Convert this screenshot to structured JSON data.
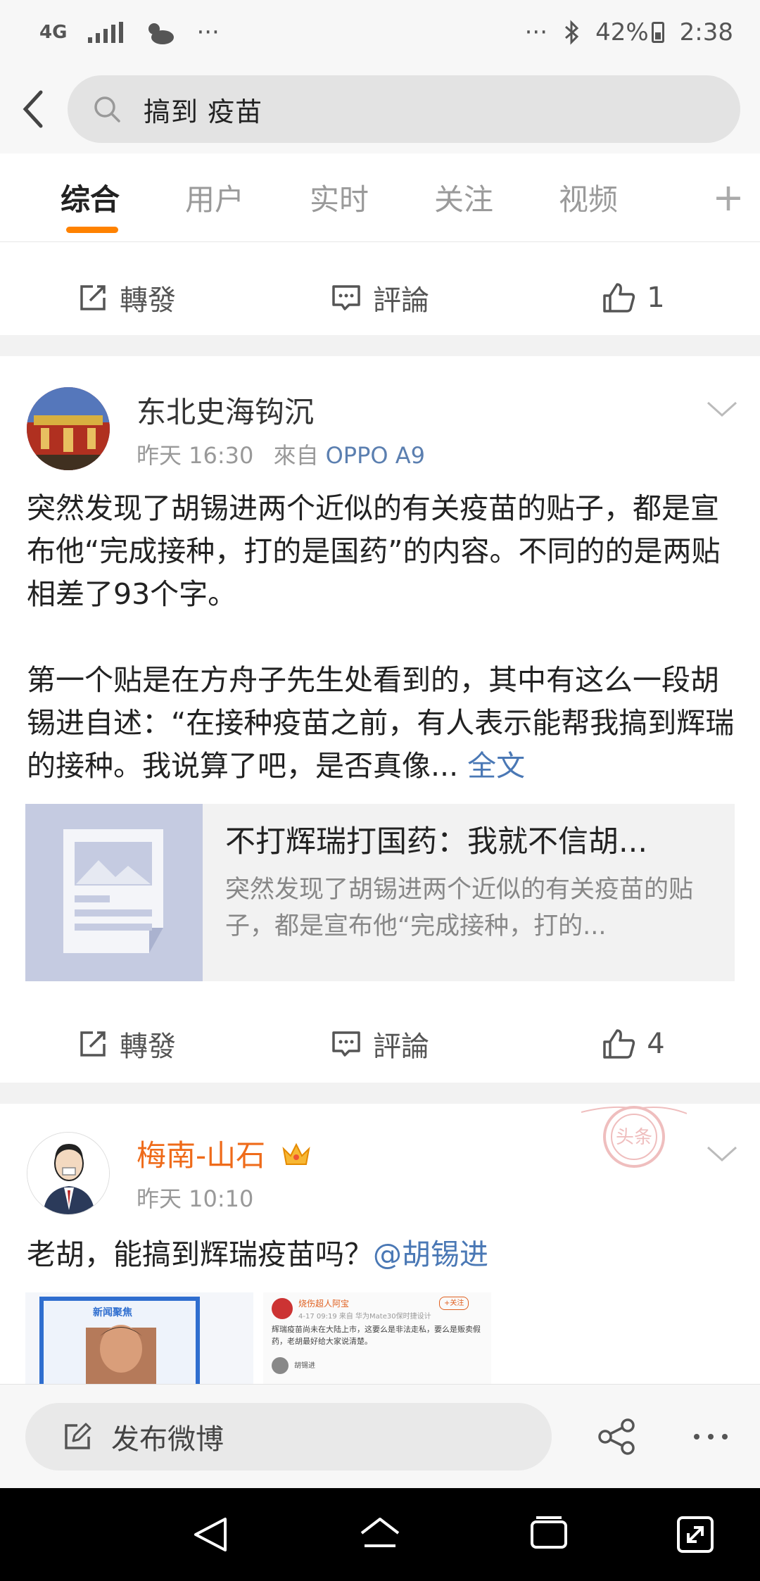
{
  "status_bar": {
    "network": "4G",
    "dots_left": "···",
    "dots_right": "···",
    "battery": "42%",
    "time": "2:38"
  },
  "search": {
    "query": "搞到 疫苗"
  },
  "tabs": [
    {
      "label": "综合",
      "active": true
    },
    {
      "label": "用户",
      "active": false
    },
    {
      "label": "实时",
      "active": false
    },
    {
      "label": "关注",
      "active": false
    },
    {
      "label": "视频",
      "active": false
    }
  ],
  "tab_more": "+",
  "prev_actions": {
    "repost": "轉發",
    "comment": "評論",
    "like_count": "1"
  },
  "post1": {
    "author": "东北史海钩沉",
    "time": "昨天 16:30",
    "source_prefix": "來自",
    "source": "OPPO A9",
    "text_p1": "突然发现了胡锡进两个近似的有关疫苗的贴子，都是宣布他“完成接种，打的是国药”的内容。不同的的是两贴相差了93个字。",
    "text_p2": "第一个贴是在方舟子先生处看到的，其中有这么一段胡锡进自述：“在接种疫苗之前，有人表示能帮我搞到辉瑞的接种。我说算了吧，是否真像...",
    "full_text_link": "全文",
    "card_title": "不打辉瑞打国药：我就不信胡...",
    "card_desc": "突然发现了胡锡进两个近似的有关疫苗的贴子，都是宣布他“完成接种，打的...",
    "repost": "轉發",
    "comment": "評論",
    "like_count": "4"
  },
  "post2": {
    "author": "梅南-山石",
    "time": "昨天 10:10",
    "text": "老胡，能搞到辉瑞疫苗吗？",
    "mention": "@胡锡进",
    "stamp_text": "头条",
    "img2_user": "烧伤超人阿宝",
    "img2_follow": "+关注",
    "img2_meta": "4-17 09:19 来自 华为Mate30保时捷设计",
    "img2_text": "辉瑞疫苗尚未在大陆上市，这要么是非法走私，要么是贩卖假药，老胡最好给大家说清楚。",
    "img2_reply": "胡锡进",
    "img1_banner": "新闻聚焦"
  },
  "publish": {
    "label": "发布微博"
  },
  "colors": {
    "accent_orange": "#ff8200",
    "link_blue": "#4a78b5",
    "author_orange": "#ef6b1a"
  },
  "icons": [
    "signal-icon",
    "weather-icon",
    "bluetooth-icon",
    "battery-icon",
    "back-icon",
    "search-icon",
    "repost-icon",
    "comment-icon",
    "like-icon",
    "chevron-down-icon",
    "crown-icon",
    "edit-icon",
    "share-icon",
    "more-icon",
    "nav-back-icon",
    "nav-home-icon",
    "nav-recents-icon",
    "nav-expand-icon"
  ]
}
